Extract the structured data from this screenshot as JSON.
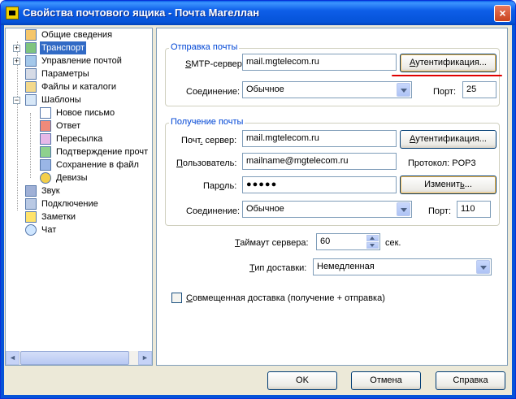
{
  "window": {
    "title": "Свойства почтового ящика - Почта Магеллан",
    "close_label": "×"
  },
  "tree": {
    "items": [
      {
        "label": "Общие сведения",
        "icon": "info-icon"
      },
      {
        "label": "Транспорт",
        "icon": "transport-icon",
        "selected": true
      },
      {
        "label": "Управление почтой",
        "icon": "mail-manage-icon"
      },
      {
        "label": "Параметры",
        "icon": "settings-icon"
      },
      {
        "label": "Файлы и каталоги",
        "icon": "folder-icon"
      },
      {
        "label": "Шаблоны",
        "icon": "templates-icon"
      },
      {
        "label": "Новое письмо",
        "icon": "new-letter-icon"
      },
      {
        "label": "Ответ",
        "icon": "reply-icon"
      },
      {
        "label": "Пересылка",
        "icon": "forward-icon"
      },
      {
        "label": "Подтверждение прочт",
        "icon": "read-receipt-icon"
      },
      {
        "label": "Сохранение в файл",
        "icon": "save-file-icon"
      },
      {
        "label": "Девизы",
        "icon": "mottos-icon"
      },
      {
        "label": "Звук",
        "icon": "sound-icon"
      },
      {
        "label": "Подключение",
        "icon": "connection-icon"
      },
      {
        "label": "Заметки",
        "icon": "notes-icon"
      },
      {
        "label": "Чат",
        "icon": "chat-icon"
      }
    ],
    "scroll_left": "◄",
    "scroll_right": "►"
  },
  "send": {
    "group_title": "Отправка почты",
    "server_label_u": "S",
    "server_label_rest": "MTP-сервер:",
    "server_value": "mail.mgtelecom.ru",
    "auth_label_u": "А",
    "auth_label_rest": "утентификация...",
    "connection_label": "Соединение:",
    "connection_value": "Обычное",
    "port_label": "Порт:",
    "port_value": "25"
  },
  "receive": {
    "group_title": "Получение почты",
    "server_label_a": "Почт",
    "server_label_u": ".",
    "server_label_b": " сервер:",
    "server_value": "mail.mgtelecom.ru",
    "auth_label_u": "А",
    "auth_label_rest": "утентификация...",
    "user_label_u": "П",
    "user_label_rest": "ользователь:",
    "user_value": "mailname@mgtelecom.ru",
    "protocol_label": "Протокол:",
    "protocol_value": "POP3",
    "password_label_a": "Пар",
    "password_label_u": "о",
    "password_label_b": "ль:",
    "password_value": "●●●●●",
    "change_label_a": "Изменит",
    "change_label_u": "ь",
    "change_label_b": "...",
    "connection_label": "Соединение:",
    "connection_value": "Обычное",
    "port_label": "Порт:",
    "port_value": "110"
  },
  "timeout": {
    "label_u": "Т",
    "label_rest": "аймаут сервера:",
    "value": "60",
    "unit": "сек."
  },
  "delivery": {
    "label_u": "Т",
    "label_rest": "ип доставки:",
    "value": "Немедленная"
  },
  "combined": {
    "label_u": "С",
    "label_rest": "овмещенная доставка (получение + отправка)",
    "checked": false
  },
  "footer": {
    "ok": "OK",
    "cancel": "Отмена",
    "help": "Справка"
  },
  "colors": {
    "accent": "#316ac5",
    "group_title": "#0046d5",
    "highlight_line": "#e00000"
  }
}
